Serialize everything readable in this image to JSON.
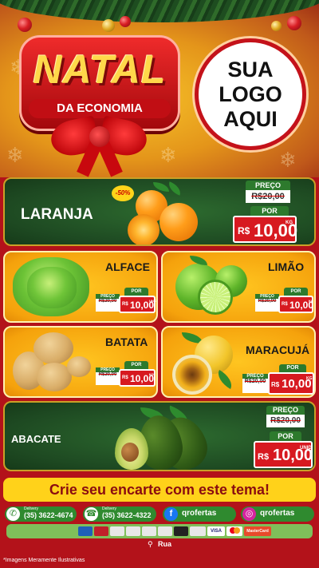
{
  "header": {
    "title": "NATAL",
    "subtitle": "DA ECONOMIA",
    "logo_lines": "SUA\nLOGO\nAQUI"
  },
  "products": [
    {
      "id": "laranja",
      "name": "LARANJA",
      "badge": "-50%",
      "old_label": "PREÇO",
      "old_price": "R$20,00",
      "new_label": "POR",
      "currency": "R$",
      "price": "10,00",
      "unit": "KG"
    },
    {
      "id": "alface",
      "name": "ALFACE",
      "old_label": "PREÇO",
      "old_price": "R$20,00",
      "new_label": "POR",
      "currency": "R$",
      "price": "10,00",
      "unit": "UNID"
    },
    {
      "id": "limao",
      "name": "LIMÃO",
      "old_label": "PREÇO",
      "old_price": "R$20,00",
      "new_label": "POR",
      "currency": "R$",
      "price": "10,00",
      "unit": "KG"
    },
    {
      "id": "batata",
      "name": "BATATA",
      "old_label": "PREÇO",
      "old_price": "R$20,00",
      "new_label": "POR",
      "currency": "R$",
      "price": "10,00",
      "unit": "KG"
    },
    {
      "id": "maracuja",
      "name": "MARACUJÁ",
      "old_label": "PREÇO",
      "old_price": "R$20,00",
      "new_label": "POR",
      "currency": "R$",
      "price": "10,00",
      "unit": "KG"
    },
    {
      "id": "abacate",
      "name": "ABACATE",
      "old_label": "PREÇO",
      "old_price": "R$20,00",
      "new_label": "POR",
      "currency": "R$",
      "price": "10,00",
      "unit": "UNID"
    }
  ],
  "banner": "Crie seu encarte com este tema!",
  "contacts": [
    {
      "icon": "whatsapp-icon",
      "small": "Delivery",
      "value": "(35) 3622-4674"
    },
    {
      "icon": "phone-icon",
      "small": "Delivery",
      "value": "(35) 3622-4322"
    },
    {
      "icon": "facebook-icon",
      "value": "qrofertas"
    },
    {
      "icon": "instagram-icon",
      "value": "qrofertas"
    }
  ],
  "payments": [
    "VISA",
    "MasterCard"
  ],
  "address": "Rua",
  "disclaimer": "*Imagens Meramente Ilustrativas",
  "colors": {
    "brand_red": "#d71920",
    "tag_green": "#2d7a2d",
    "gold": "#ffd21a"
  }
}
